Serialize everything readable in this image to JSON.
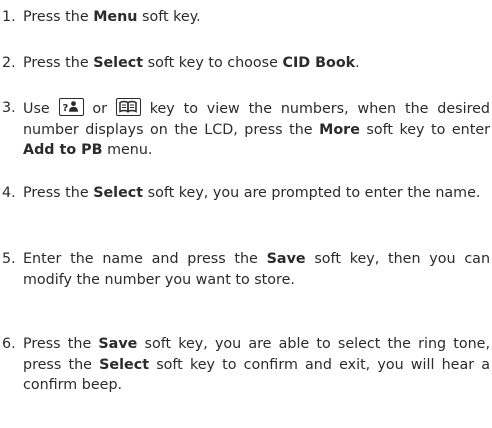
{
  "steps": [
    {
      "num": "1.",
      "parts": {
        "a": "Press the ",
        "b": "Menu",
        "c": " soft key."
      }
    },
    {
      "num": "2.",
      "parts": {
        "a": "Press the ",
        "b": "Select",
        "c": " soft key to choose ",
        "d": "CID Book",
        "e": "."
      }
    },
    {
      "num": "3.",
      "parts": {
        "a": "Use ",
        "b": " or ",
        "c": " key to view the numbers, when the desired number displays on the LCD, press the ",
        "d": "More",
        "e": " soft key to enter ",
        "f": "Add to PB",
        "g": " menu."
      }
    },
    {
      "num": "4.",
      "parts": {
        "a": "Press the ",
        "b": "Select",
        "c": " soft key, you are prompted to enter the name."
      }
    },
    {
      "num": "5.",
      "parts": {
        "a": "Enter the name and press the ",
        "b": "Save",
        "c": " soft key, then you can modify the number you want to store."
      }
    },
    {
      "num": "6.",
      "parts": {
        "a": "Press the ",
        "b": "Save",
        "c": " soft key, you are able to select the ring tone, press the ",
        "d": "Select",
        "e": " soft key to confirm and exit, you will hear a confirm beep."
      }
    }
  ],
  "icons": {
    "key1": "call-log-key-icon",
    "key2": "phonebook-key-icon"
  }
}
